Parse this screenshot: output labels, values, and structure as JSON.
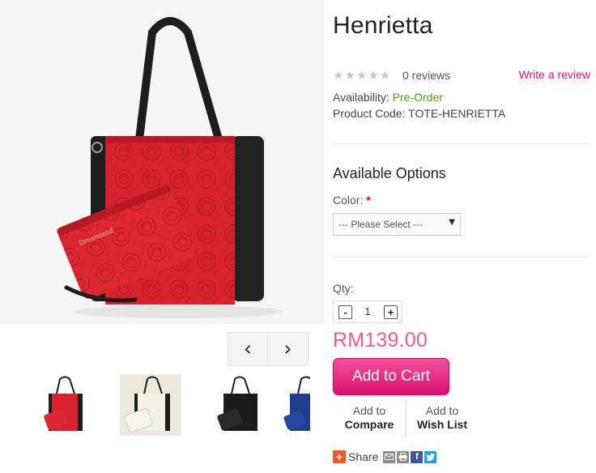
{
  "product": {
    "title": "Henrietta",
    "rating_stars": "★★★★★",
    "rating_value": 0,
    "reviews": "0 reviews",
    "write_review": "Write a review",
    "availability_label": "Availability:",
    "availability_value": "Pre-Order",
    "code_label": "Product Code:",
    "code_value": "TOTE-HENRIETTA",
    "price": "RM139.00"
  },
  "options": {
    "section_title": "Available Options",
    "color_label": "Color:",
    "required_marker": "*",
    "color_select_value": "--- Please Select ---"
  },
  "quantity": {
    "label": "Qty:",
    "value": "1",
    "minus": "-",
    "plus": "+"
  },
  "actions": {
    "add_to_cart": "Add to Cart",
    "compare_line1": "Add to",
    "compare_line2": "Compare",
    "wishlist_line1": "Add to",
    "wishlist_line2": "Wish List"
  },
  "share": {
    "label": "Share",
    "icons": [
      "share-plus-icon",
      "email-icon",
      "print-icon",
      "facebook-icon",
      "twitter-icon"
    ]
  },
  "gallery": {
    "prev_icon": "chevron-left-icon",
    "next_icon": "chevron-right-icon",
    "thumbnails": [
      "red",
      "white",
      "black",
      "navy"
    ]
  },
  "colors": {
    "accent_pink": "#e0157a",
    "price_pink": "#ec5a94",
    "availability_green": "#46a31c",
    "bag_red": "#d8232e",
    "bag_black": "#1e1e1e",
    "facebook_blue": "#3b5998",
    "twitter_blue": "#1da1f2"
  }
}
